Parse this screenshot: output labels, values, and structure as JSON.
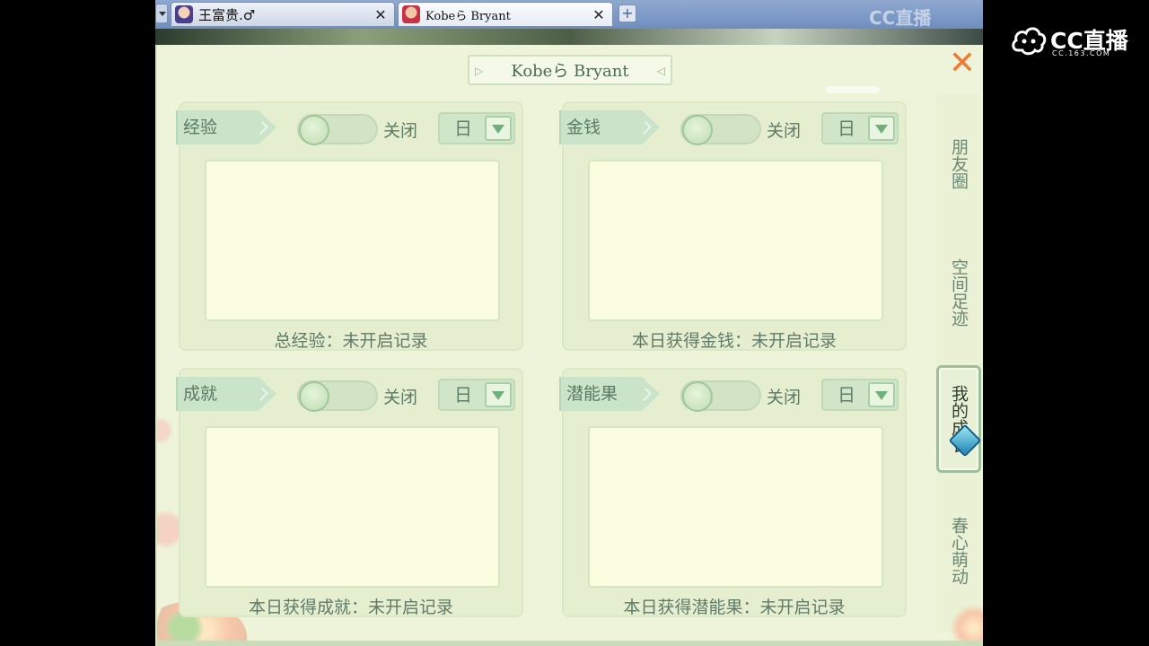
{
  "browser": {
    "tabs": [
      {
        "title": "王富贵.♂",
        "active": false
      },
      {
        "title": "Kobeら Bryant",
        "active": true
      }
    ],
    "tab_close_glyph": "✕",
    "tab_add_glyph": "+",
    "watermark": "CC直播"
  },
  "brand": {
    "name": "CC直播",
    "url": "CC.163.COM"
  },
  "panel": {
    "title": "Kobeら Bryant",
    "close_glyph": "✕"
  },
  "cards": [
    {
      "tag": "经验",
      "toggle_label": "关闭",
      "toggle_on": false,
      "period": "日",
      "status": "总经验：未开启记录"
    },
    {
      "tag": "金钱",
      "toggle_label": "关闭",
      "toggle_on": false,
      "period": "日",
      "status": "本日获得金钱：未开启记录"
    },
    {
      "tag": "成就",
      "toggle_label": "关闭",
      "toggle_on": false,
      "period": "日",
      "status": "本日获得成就：未开启记录"
    },
    {
      "tag": "潜能果",
      "toggle_label": "关闭",
      "toggle_on": false,
      "period": "日",
      "status": "本日获得潜能果：未开启记录"
    }
  ],
  "side_nav": [
    {
      "label": "朋友圈",
      "active": false
    },
    {
      "label": "空间足迹",
      "active": false
    },
    {
      "label": "我的成长",
      "active": true
    },
    {
      "label": "春心萌动",
      "active": false
    }
  ],
  "colors": {
    "accent_close": "#f07b35",
    "panel_bg": "#eef4da",
    "card_tag": "#c9e4c9"
  },
  "icons": {
    "close": "close-icon",
    "dropdown": "chevron-down-icon",
    "tab_add": "plus-icon"
  }
}
